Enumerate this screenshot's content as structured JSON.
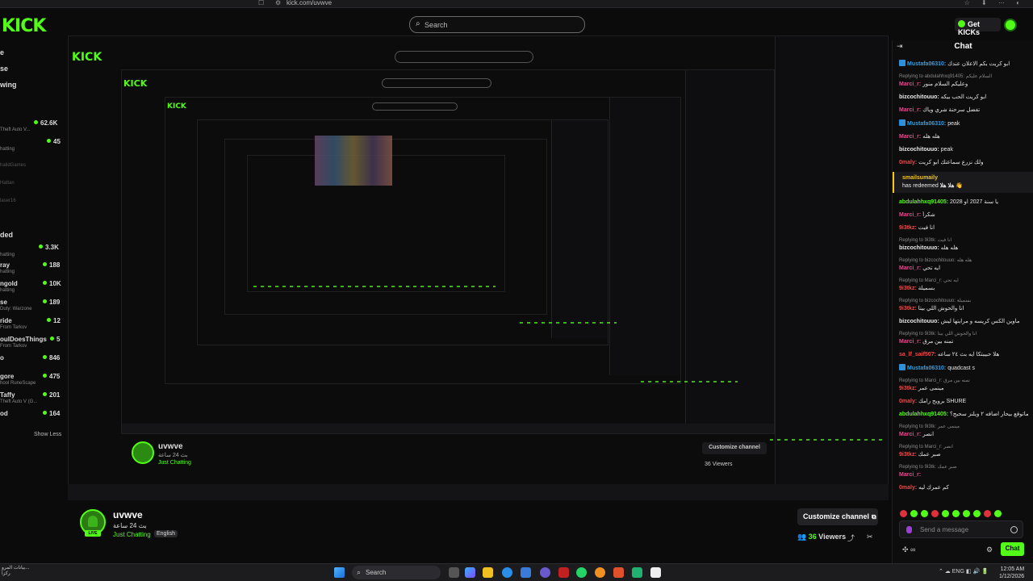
{
  "browser": {
    "url": "kick.com/uvwve"
  },
  "header": {
    "logo": "KICK",
    "search_placeholder": "Search",
    "get_kicks_label": "Get KICKs"
  },
  "sidebar": {
    "items": [
      {
        "label": "e"
      },
      {
        "label": "se"
      },
      {
        "label": "wing"
      }
    ],
    "channels": [
      {
        "name": "Theft Auto V...",
        "viewers": "62.6K"
      },
      {
        "name": "hatting",
        "viewers": "45"
      },
      {
        "name": "haildGames",
        "viewers": ""
      },
      {
        "name": "Hattan",
        "viewers": ""
      },
      {
        "name": "laser16",
        "viewers": ""
      }
    ],
    "recommended_header": "ded",
    "recommended": [
      {
        "name": "hatting",
        "viewers": "3.3K"
      },
      {
        "name": "ray",
        "sub": "hatting",
        "viewers": "188"
      },
      {
        "name": "ngold",
        "sub": "hatting",
        "viewers": "10K"
      },
      {
        "name": "se",
        "sub": "Duty: Warzone",
        "viewers": "189"
      },
      {
        "name": "ride",
        "sub": "From Tarkov",
        "viewers": "12"
      },
      {
        "name": "oulDoesThings",
        "sub": "From Tarkov",
        "viewers": "5"
      },
      {
        "name": "o",
        "viewers": "846"
      },
      {
        "name": "gore",
        "sub": "hool RuneScape",
        "viewers": "475"
      },
      {
        "name": "Taffy",
        "sub": "Theft Auto V (G...",
        "viewers": "201"
      },
      {
        "name": "od",
        "viewers": "164"
      }
    ],
    "show_less": "Show Less"
  },
  "video": {
    "streamer": "uvwve",
    "title": "بث 24 ساعة",
    "category": "Just Chatting",
    "language": "English",
    "customize": "Customize channel",
    "viewers": "36 Viewers"
  },
  "stream": {
    "name": "uvwve",
    "title": "بث 24 ساعة",
    "category": "Just Chatting",
    "language": "English",
    "live_badge": "LIVE",
    "customize_label": "Customize channel",
    "viewers_count": "36",
    "viewers_label": "Viewers"
  },
  "chat": {
    "title": "Chat",
    "messages": [
      {
        "user": "Mustafa06310:",
        "text": "ابو كريت بكم الاعلان عندك",
        "color": "#2f9fe8",
        "badge": true
      },
      {
        "reply": "Replying to abdulahhxq91405: السلام عليكم",
        "user": "Marci_r:",
        "text": "وعليكم السلام منور",
        "color": "#e84b8a"
      },
      {
        "user": "bizcochitouuo:",
        "text": "ابو كريت الحب بيكه",
        "color": "#e8e8e8"
      },
      {
        "user": "Marci_r:",
        "text": "تفضل سرحنة شري وياك",
        "color": "#e84b8a"
      },
      {
        "user": "Mustafa06310:",
        "text": "peak",
        "color": "#2f9fe8",
        "badge": true
      },
      {
        "user": "Marci_r:",
        "text": "هله هله",
        "color": "#e84b8a"
      },
      {
        "user": "bizcochitouuo:",
        "text": "peak",
        "color": "#e8e8e8"
      },
      {
        "user": "0maly:",
        "text": "ولك نزرع سماعتك ابو كريت",
        "color": "#e84b4b"
      }
    ],
    "redeem": {
      "user": "smailsumaily",
      "text": "has redeemed",
      "reward": "هلا هلا 👋"
    },
    "messages2": [
      {
        "user": "abdulahhxq91405:",
        "text": "يا سنة 2027 او 2028",
        "color": "#53fc18"
      },
      {
        "user": "Marci_r:",
        "text": "شكراً",
        "color": "#e84b8a"
      },
      {
        "user": "9i3tkz:",
        "text": "انا فيت",
        "color": "#e84b4b"
      },
      {
        "reply": "Replying to 9i3tk: انا فيت",
        "user": "bizcochitouuo:",
        "text": "هله هله",
        "color": "#e8e8e8"
      },
      {
        "reply": "Replying to bizcochitouuo: هله هله",
        "user": "Marci_r:",
        "text": "ايه تحي",
        "color": "#e84b8a"
      },
      {
        "reply": "Replying to Marci_r: ايه تحي",
        "user": "9i3tkz:",
        "text": "بسميلة",
        "color": "#e84b4b"
      },
      {
        "reply": "Replying to bizcochitouuo: بسميلة",
        "user": "9i3tkz:",
        "text": "انا والحوش اللي بيتا",
        "color": "#e84b4b"
      },
      {
        "user": "bizcochitouuo:",
        "text": "ماوين الكس كريسه و مرايتها ليش",
        "color": "#e8e8e8"
      },
      {
        "reply": "Replying to 9i3tk: انا والحوش اللي بيتا",
        "user": "Marci_r:",
        "text": "تمنه بين مرق",
        "color": "#e84b8a"
      },
      {
        "user": "sa_lf_saif507:",
        "text": "هلا حبيبتكا ايه بث ٢٤ ساعه",
        "color": "#e84b4b"
      },
      {
        "user": "Mustafa06310:",
        "text": "quadcast s",
        "color": "#2f9fe8",
        "badge": true
      },
      {
        "reply": "Replying to Marci_r: تمنه بين مرق",
        "user": "9i3tkz:",
        "text": "مينمى عمر",
        "color": "#e84b4b"
      },
      {
        "user": "0maly:",
        "text": "برويح رامك SHURE",
        "color": "#e84b4b"
      },
      {
        "user": "abdulahhxq91405:",
        "text": "ماتوقع بيحار اضافه ٢ ويلنز سحبج؟",
        "color": "#53fc18"
      },
      {
        "reply": "Replying to 9i3tk: مينمى عمر",
        "user": "Marci_r:",
        "text": "انصر",
        "color": "#e84b8a"
      },
      {
        "reply": "Replying to Marci_r: انصر",
        "user": "9i3tkz:",
        "text": "صبر عمك",
        "color": "#e84b4b"
      },
      {
        "reply": "Replying to 9i3tk: صبر عمك",
        "user": "Marci_r:",
        "text": "",
        "color": "#e84b8a"
      },
      {
        "user": "0maly:",
        "text": "كم عمرك ليه",
        "color": "#e84b4b"
      }
    ],
    "input_placeholder": "Send a message",
    "send_label": "Chat"
  },
  "taskbar": {
    "left_text": "بيانات المرو...",
    "left_sub": "ركزا",
    "search_placeholder": "Search",
    "tray_lang": "ENG",
    "time": "12:05 AM",
    "date": "1/12/2026"
  }
}
